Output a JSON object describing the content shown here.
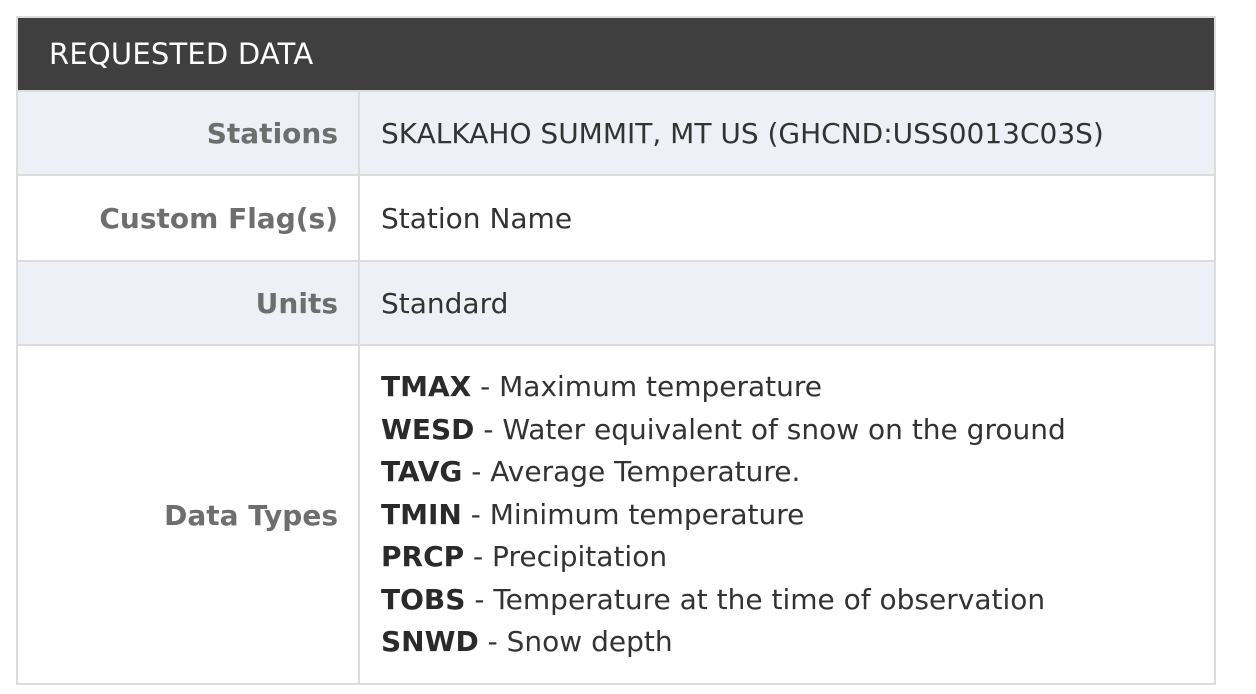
{
  "header": {
    "title": "REQUESTED DATA"
  },
  "rows": {
    "stations": {
      "label": "Stations",
      "value": "SKALKAHO SUMMIT, MT US (GHCND:USS0013C03S)"
    },
    "custom_flags": {
      "label": "Custom Flag(s)",
      "value": "Station Name"
    },
    "units": {
      "label": "Units",
      "value": "Standard"
    },
    "data_types": {
      "label": "Data Types",
      "items": [
        {
          "code": "TMAX",
          "desc": " - Maximum temperature"
        },
        {
          "code": "WESD",
          "desc": " - Water equivalent of snow on the ground"
        },
        {
          "code": "TAVG",
          "desc": " - Average Temperature."
        },
        {
          "code": "TMIN",
          "desc": " - Minimum temperature"
        },
        {
          "code": "PRCP",
          "desc": " - Precipitation"
        },
        {
          "code": "TOBS",
          "desc": " - Temperature at the time of observation"
        },
        {
          "code": "SNWD",
          "desc": " - Snow depth"
        }
      ]
    }
  },
  "colors": {
    "header_bg": "#3f3f3f",
    "shaded_row_bg": "#eef0f7",
    "border": "#dcdcdc",
    "label_text": "#6e6e6e"
  }
}
